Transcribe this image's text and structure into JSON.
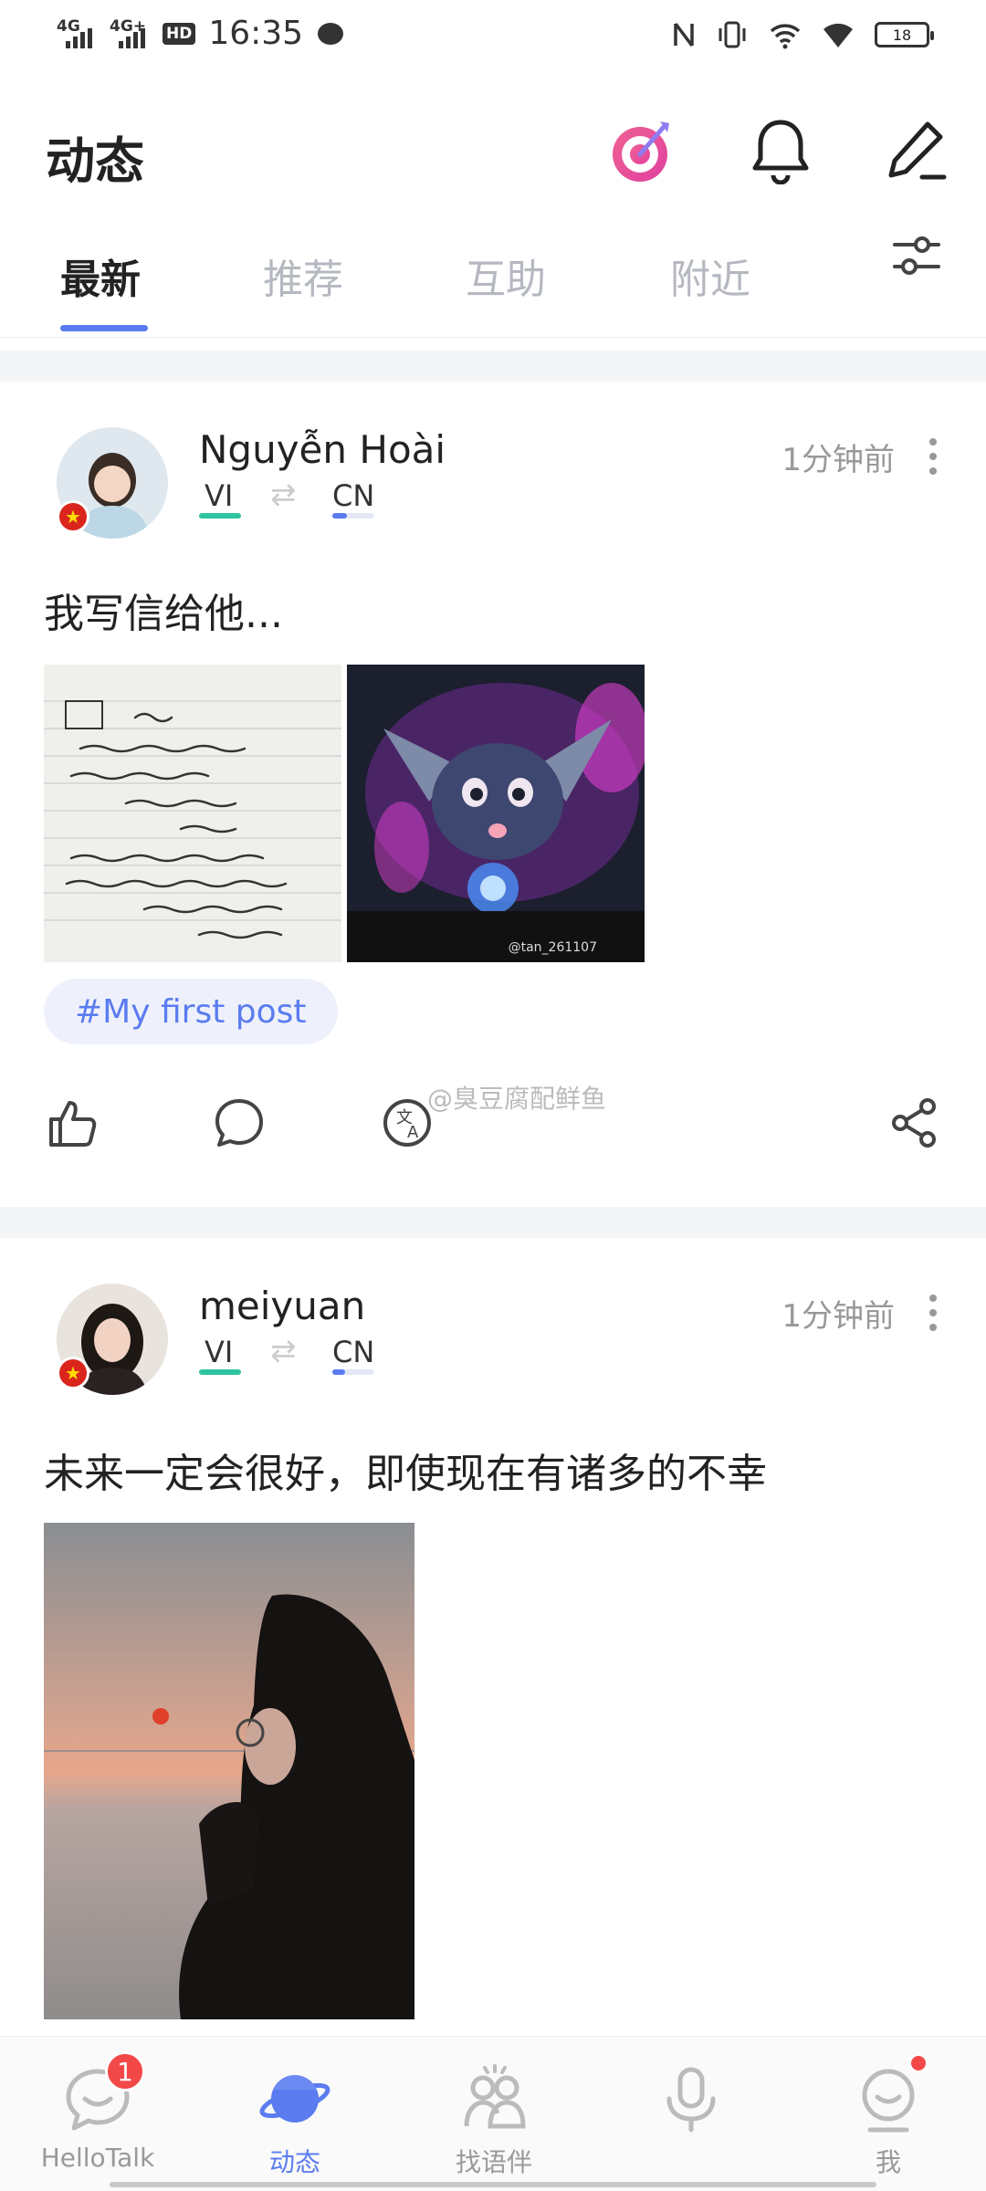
{
  "status_bar": {
    "network1": "4G",
    "network2": "4G+",
    "hd": "HD",
    "time": "16:35",
    "battery": "18"
  },
  "header": {
    "title": "动态",
    "icons": [
      "target-icon",
      "bell-icon",
      "edit-icon"
    ]
  },
  "tabs": [
    {
      "label": "最新",
      "active": true
    },
    {
      "label": "推荐",
      "active": false
    },
    {
      "label": "互助",
      "active": false
    },
    {
      "label": "附近",
      "active": false
    }
  ],
  "posts": [
    {
      "username": "Nguyễn Hoài",
      "native_lang": "VI",
      "learning_lang": "CN",
      "time": "1分钟前",
      "text": "我写信给他...",
      "tag": "#My first post",
      "images": [
        "handwritten-letter-photo",
        "anime-character-photo"
      ],
      "image_caption": "@tan_261107"
    },
    {
      "username": "meiyuan",
      "native_lang": "VI",
      "learning_lang": "CN",
      "time": "1分钟前",
      "text": "未来一定会很好，即使现在有诸多的不幸",
      "images": [
        "sunset-girl-photo"
      ]
    }
  ],
  "watermark": "@臭豆腐配鲜鱼",
  "bottom_nav": [
    {
      "label": "HelloTalk",
      "badge": "1",
      "active": false
    },
    {
      "label": "动态",
      "active": true
    },
    {
      "label": "找语伴",
      "active": false
    },
    {
      "label": "",
      "active": false
    },
    {
      "label": "我",
      "active": false
    }
  ],
  "colors": {
    "accent": "#5b7cf0",
    "native_bar": "#2ec4a0",
    "badge": "#f24848"
  }
}
